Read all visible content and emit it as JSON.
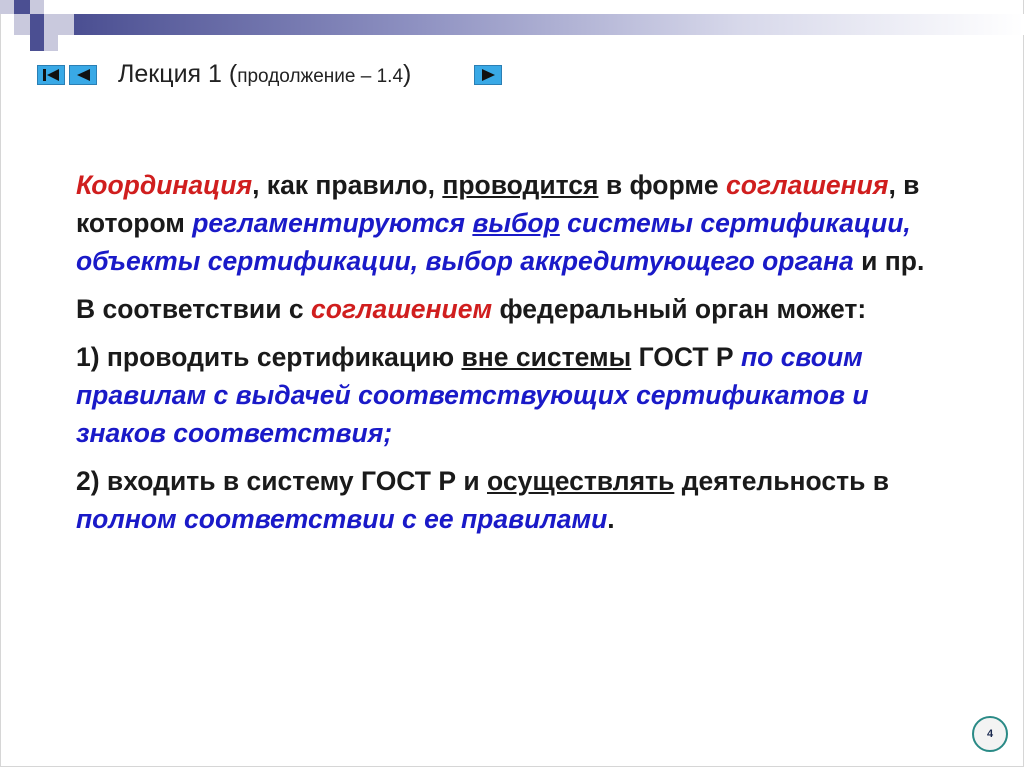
{
  "slide": {
    "title_main": "Лекция 1 (",
    "title_small": "продолжение – 1.4",
    "title_close": ")",
    "page_number": "4"
  },
  "nav": {
    "first_icon": "skip-to-start-icon",
    "prev_icon": "play-back-icon",
    "next_icon": "play-forward-icon"
  },
  "content": {
    "p1": {
      "a": "Координация",
      "b": ", как правило, ",
      "c": "проводится",
      "d": " в форме ",
      "e": "соглашения",
      "f": ", в котором ",
      "g": "регламентируются ",
      "h": "выбор",
      "i": " системы сертификации, объекты сертификации, выбор аккредитующего органа",
      "j": " и пр."
    },
    "p2": {
      "a": "В соответствии с ",
      "b": "соглашением",
      "c": " федеральный орган может:"
    },
    "p3": {
      "a": "1) проводить сертификацию ",
      "b": "вне системы",
      "c": " ГОСТ Р ",
      "d": "по своим правилам с выдачей соответствующих сертификатов и знаков соответствия;"
    },
    "p4": {
      "a": "2) входить в систему ГОСТ Р и ",
      "b": "осуществлять",
      "c": " деятельность в ",
      "d": "полном соответствии с ее правилами",
      "e": "."
    }
  },
  "colors": {
    "accent_red": "#d01e1e",
    "accent_blue": "#1a1ac8",
    "nav_button": "#39a9e6",
    "header_bar": "#4b4f92"
  }
}
